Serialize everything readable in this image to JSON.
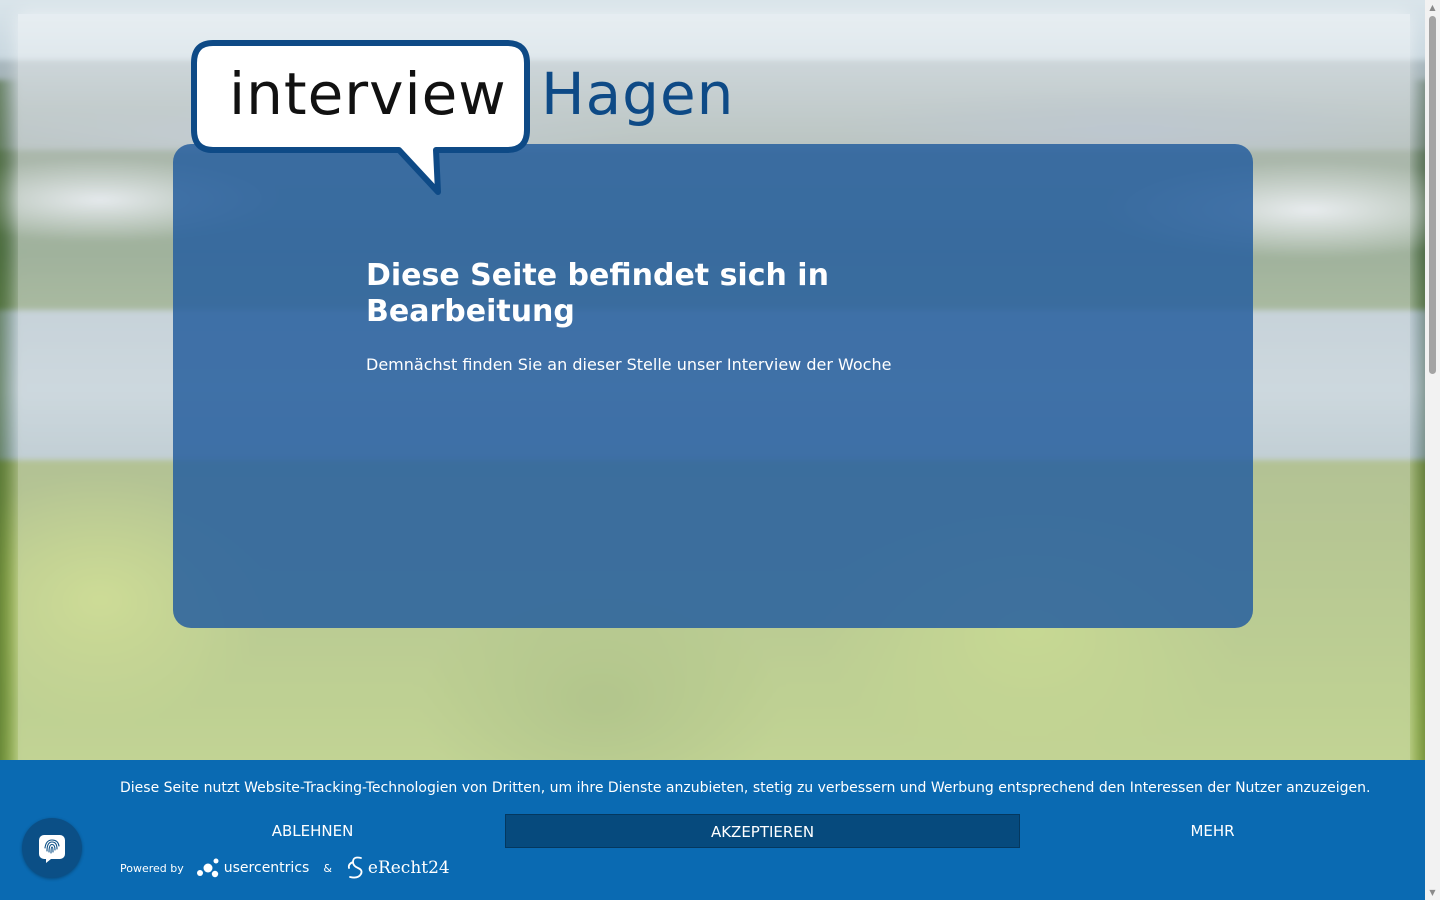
{
  "logo": {
    "word_1": "interview",
    "word_2": "Hagen",
    "bubble_color": "#0e4a86",
    "word_2_color": "#0e4a86"
  },
  "main": {
    "title": "Diese Seite befindet sich in Bearbeitung",
    "text": "Demnächst finden Sie an dieser Stelle unser Interview der Woche",
    "card_color": "#28609e"
  },
  "cookie_banner": {
    "text": "Diese Seite nutzt Website-Tracking-Technologien von Dritten, um ihre Dienste anzubieten, stetig zu verbessern und Werbung entsprechend den Interessen der Nutzer anzuzeigen.",
    "decline_label": "ABLEHNEN",
    "accept_label": "AKZEPTIEREN",
    "more_label": "MEHR",
    "powered_by": "Powered by",
    "provider_1": "usercentrics",
    "ampersand": "&",
    "provider_2": "eRecht24",
    "banner_color": "#0a6ab2",
    "accept_color": "#064a7d"
  },
  "icons": {
    "privacy_button": "fingerprint-icon"
  }
}
